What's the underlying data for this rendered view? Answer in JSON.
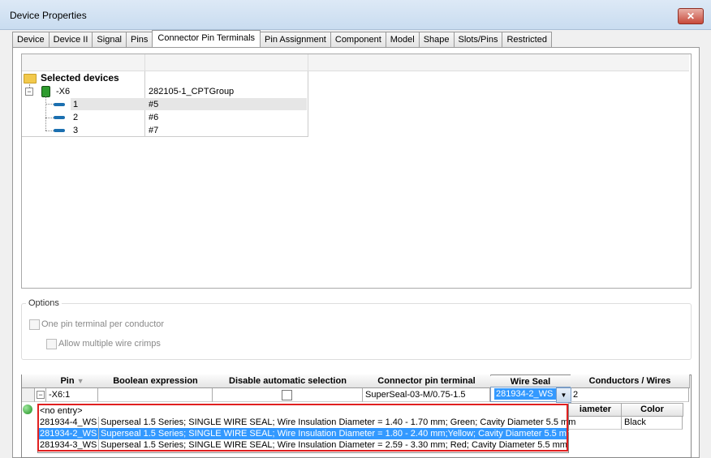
{
  "window": {
    "title": "Device Properties",
    "close_label": "✕"
  },
  "tabs": [
    {
      "label": "Device"
    },
    {
      "label": "Device II"
    },
    {
      "label": "Signal"
    },
    {
      "label": "Pins"
    },
    {
      "label": "Connector Pin Terminals",
      "active": true
    },
    {
      "label": "Pin Assignment"
    },
    {
      "label": "Component"
    },
    {
      "label": "Model"
    },
    {
      "label": "Shape"
    },
    {
      "label": "Slots/Pins"
    },
    {
      "label": "Restricted"
    }
  ],
  "tree": {
    "root_label": "Selected devices",
    "device": {
      "name": "-X6",
      "value": "282105-1_CPTGroup"
    },
    "pins": [
      {
        "name": "1",
        "value": "#5"
      },
      {
        "name": "2",
        "value": "#6"
      },
      {
        "name": "3",
        "value": "#7"
      }
    ]
  },
  "options": {
    "label": "Options",
    "one_pin_terminal": "One pin terminal per conductor",
    "allow_multiple_crimps": "Allow multiple wire crimps"
  },
  "grid": {
    "headers": {
      "pin": "Pin",
      "boolean": "Boolean expression",
      "disable_auto": "Disable automatic selection",
      "connector_terminal": "Connector pin terminal",
      "wire_seal": "Wire Seal",
      "conductors": "Conductors / Wires"
    },
    "row": {
      "pin": "-X6:1",
      "connector_terminal": "SuperSeal-03-M/0.75-1.5",
      "wire_seal": "281934-2_WS",
      "conductors": "2"
    },
    "subheaders": {
      "diameter": "iameter",
      "color": "Color"
    },
    "sub_row": {
      "color": "Black"
    }
  },
  "dropdown": {
    "items": [
      {
        "code": "<no entry>",
        "desc": ""
      },
      {
        "code": "281934-4_WS",
        "desc": "Superseal 1.5 Series; SINGLE WIRE SEAL; Wire Insulation Diameter = 1.40 - 1.70 mm; Green; Cavity Diameter 5.5 mm"
      },
      {
        "code": "281934-2_WS",
        "desc": "Superseal 1.5 Series; SINGLE WIRE SEAL; Wire Insulation Diameter = 1.80 - 2.40 mm;Yellow; Cavity Diameter 5.5 mm",
        "selected": true
      },
      {
        "code": "281934-3_WS",
        "desc": "Superseal 1.5 Series; SINGLE WIRE SEAL; Wire Insulation Diameter = 2.59 - 3.30 mm; Red; Cavity Diameter 5.5 mm"
      }
    ]
  }
}
